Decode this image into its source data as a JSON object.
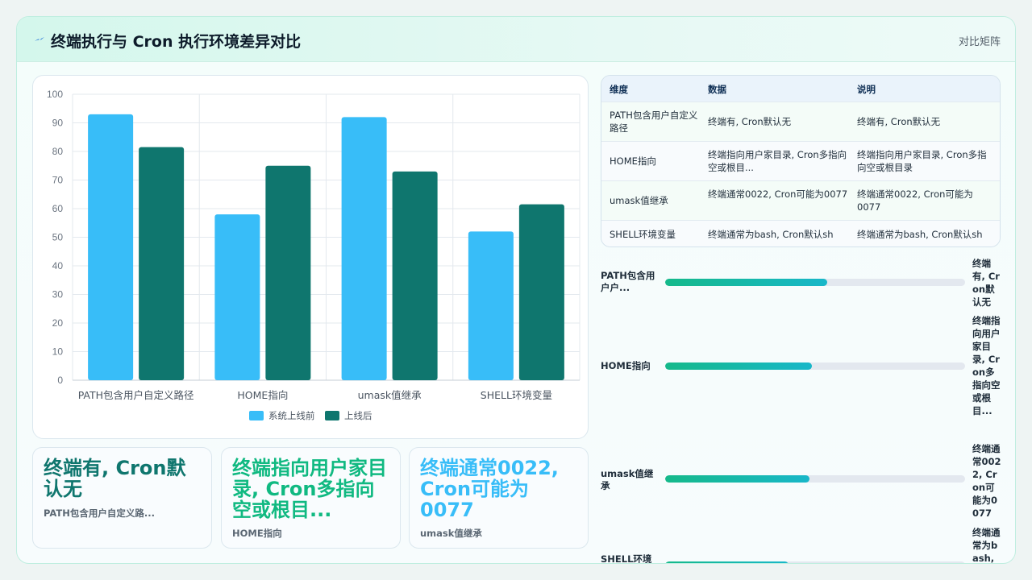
{
  "header": {
    "title": "终端执行与 Cron 执行环境差异对比",
    "meta": "对比矩阵",
    "icon": "lightning-icon"
  },
  "colors": {
    "series_before": "#38bdf8",
    "series_after": "#0f766e",
    "tile_1": "#0f766e",
    "tile_2": "#10b981",
    "tile_3": "#38bdf8"
  },
  "chart_data": {
    "type": "bar",
    "categories": [
      "PATH包含用户自定义路径",
      "HOME指向",
      "umask值继承",
      "SHELL环境变量"
    ],
    "series": [
      {
        "name": "系统上线前",
        "values": [
          93,
          58,
          92,
          52
        ]
      },
      {
        "name": "上线后",
        "values": [
          81.5,
          75,
          73,
          61.5
        ]
      }
    ],
    "yticks": [
      0,
      10,
      20,
      30,
      40,
      50,
      60,
      70,
      80,
      90,
      100
    ],
    "ylim": [
      0,
      100
    ],
    "grid": true,
    "legend": "bottom"
  },
  "tiles": [
    {
      "value": "终端有, Cron默认无",
      "label": "PATH包含用户自定义路..."
    },
    {
      "value": "终端指向用户家目录, Cron多指向空或根目...",
      "label": "HOME指向"
    },
    {
      "value": "终端通常0022, Cron可能为0077",
      "label": "umask值继承"
    }
  ],
  "table": {
    "headers": [
      "维度",
      "数据",
      "说明"
    ],
    "rows": [
      [
        "PATH包含用户自定义路径",
        "终端有, Cron默认无",
        "终端有, Cron默认无"
      ],
      [
        "HOME指向",
        "终端指向用户家目录, Cron多指向空或根目...",
        "终端指向用户家目录, Cron多指向空或根目录"
      ],
      [
        "umask值继承",
        "终端通常0022, Cron可能为0077",
        "终端通常0022, Cron可能为0077"
      ],
      [
        "SHELL环境变量",
        "终端通常为bash, Cron默认sh",
        "终端通常为bash, Cron默认sh"
      ]
    ]
  },
  "progress": [
    {
      "label": "PATH包含用户户...",
      "value": "终端有, Cron默认无",
      "fill": 0.54
    },
    {
      "label": "HOME指向",
      "value": "终端指向用户家目录, Cron多指向空或根目...",
      "fill": 0.49
    },
    {
      "label": "umask值继承",
      "value": "终端通常0022, Cron可能为0077",
      "fill": 0.48
    },
    {
      "label": "SHELL环境变...",
      "value": "终端通常为bash, Cron默认sh",
      "fill": 0.41
    }
  ]
}
